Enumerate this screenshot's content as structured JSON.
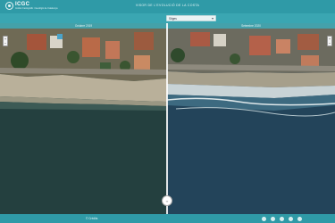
{
  "header": {
    "logo_name": "ICGC",
    "logo_sub": "Institut Cartogràfic i Geològic de Catalunya",
    "title": "VISOR DE L'EVOLUCIÓ DE LA COSTA"
  },
  "selector": {
    "value": "Sitges"
  },
  "panes": {
    "left_label": "Octubre 2019",
    "right_label": "Setembre 2020"
  },
  "zoom": {
    "plus": "+",
    "minus": "−"
  },
  "handle": {
    "glyph": "‹›"
  },
  "footer": {
    "credits": "© Crèdits",
    "socials": [
      "share-icon",
      "twitter-icon",
      "facebook-icon",
      "google-icon",
      "link-icon"
    ]
  },
  "colors": {
    "bar": "#2f9aa7",
    "select_bar": "#3aa6b2",
    "sea_left": "#24403f",
    "sea_right": "#23445a"
  }
}
